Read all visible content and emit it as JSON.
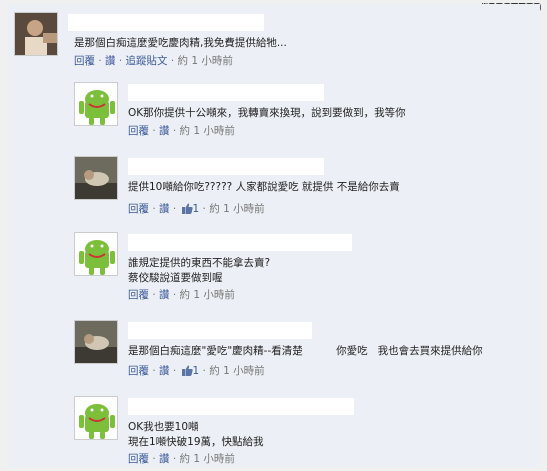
{
  "post_id": "#1205589",
  "comments": [
    {
      "text": "是那個白痴這麼愛吃慶肉精,我免費提供給牠...",
      "reply": "回覆",
      "like": "讚",
      "extra": "追蹤貼文",
      "likes": "",
      "time": "約 1 小時前"
    },
    {
      "text": "OK那你提供十公噸來，我轉賣來換現，說到要做到，我等你",
      "reply": "回覆",
      "like": "讚",
      "extra": "",
      "likes": "",
      "time": "約 1 小時前"
    },
    {
      "text": "提供10噸給你吃????? 人家都說愛吃 就提供 不是給你去賣",
      "reply": "回覆",
      "like": "讚",
      "extra": "",
      "likes": "1",
      "time": "約 1 小時前"
    },
    {
      "text": "誰規定提供的東西不能拿去賣?\n蔡佼駿說道要做到喔",
      "reply": "回覆",
      "like": "讚",
      "extra": "",
      "likes": "",
      "time": "約 1 小時前"
    },
    {
      "text": "是那個白痴這麼\"愛吃\"慶肉精--看清楚          你愛吃   我也會去買來提供給你",
      "reply": "回覆",
      "like": "讚",
      "extra": "",
      "likes": "1",
      "time": "約 1 小時前"
    },
    {
      "text": "OK我也要10噸\n現在1噸快破19萬，快點給我",
      "reply": "回覆",
      "like": "讚",
      "extra": "",
      "likes": "",
      "time": "約 1 小時前"
    }
  ],
  "colors": {
    "link": "#3b5998",
    "background": "#eceff5",
    "android_green": "#7cbf3a"
  }
}
